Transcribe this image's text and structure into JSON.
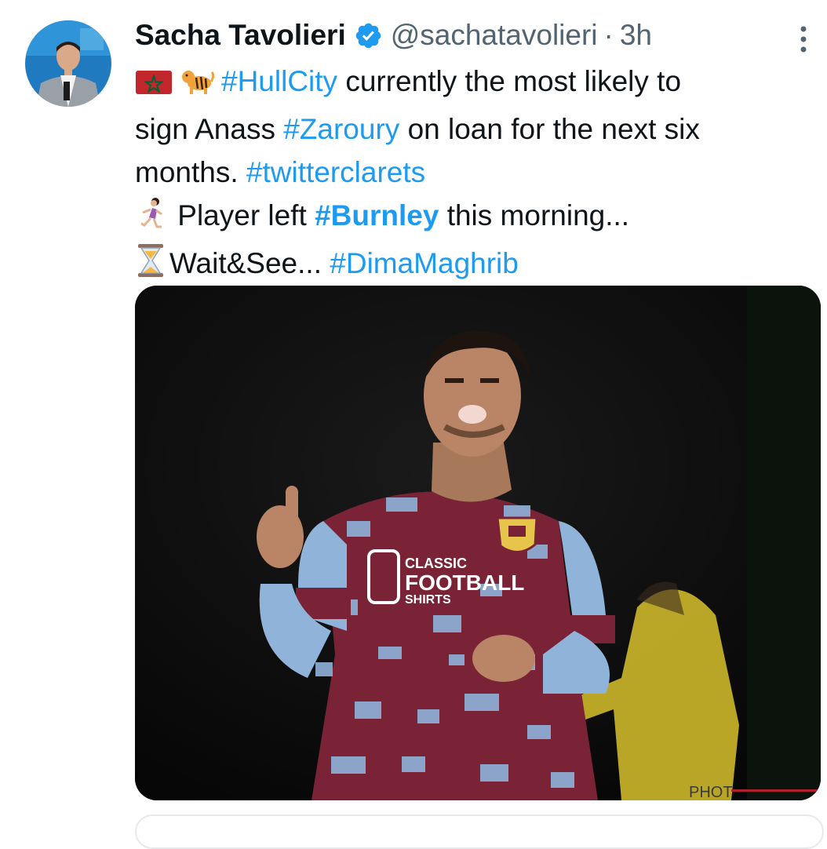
{
  "tweet": {
    "author": {
      "display_name": "Sacha Tavolieri",
      "handle": "@sachatavolieri",
      "verified_badge": "verified-badge-icon"
    },
    "separator": "·",
    "timestamp": "3h",
    "more_icon": "more-vertical-icon",
    "text": {
      "line1": {
        "emojis": [
          "morocco-flag",
          "tiger"
        ],
        "hashtag": "#HullCity",
        "text": " currently the most likely to"
      },
      "line2": {
        "text_before": "sign Anass ",
        "hashtag": "#Zaroury",
        "text_after": " on loan for the next six"
      },
      "line3": {
        "text": "months. ",
        "hashtag": "#twitterclarets"
      },
      "line4": {
        "emoji": "running-woman",
        "text_before": " Player left ",
        "hashtag": "#Burnley",
        "text_after": " this morning..."
      },
      "line5": {
        "emoji": "hourglass",
        "text": "Wait&See... ",
        "hashtag": "#DimaMaghrib"
      }
    },
    "media": {
      "shirt_text_1": "CLASSIC",
      "shirt_text_2": "FOOTBALL",
      "shirt_text_3": "SHIRTS",
      "watermark": "PHOT"
    }
  },
  "colors": {
    "link": "#1d9bf0",
    "text": "#0f1419",
    "secondary": "#536471",
    "claret": "#7a2236",
    "sky_blue": "#8fb3d9"
  }
}
